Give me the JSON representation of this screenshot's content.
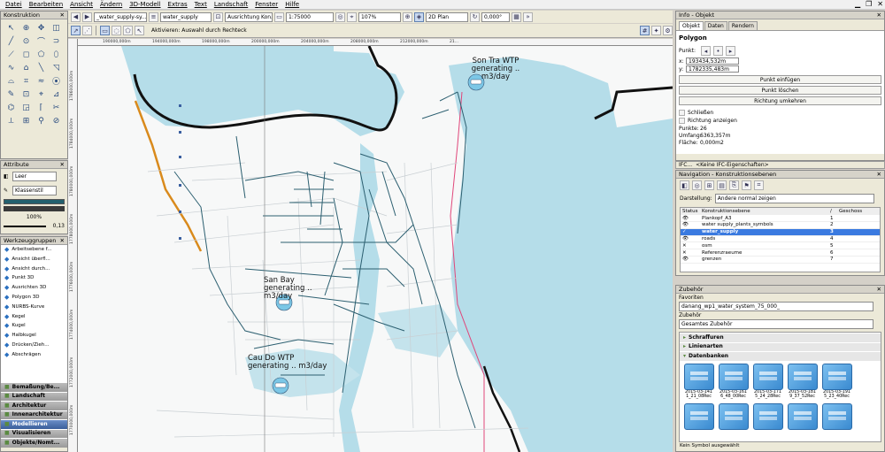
{
  "menu": [
    "Datei",
    "Bearbeiten",
    "Ansicht",
    "Ändern",
    "3D-Modell",
    "Extras",
    "Text",
    "Landschaft",
    "Fenster",
    "Hilfe"
  ],
  "toolbar1": {
    "layer_class": "_water_supply-sy...",
    "layer_name": "water_supply",
    "view": "Ausrichtung Kon...",
    "scale": "1:75000",
    "zoom": "107%",
    "plan": "2D Plan",
    "angle": "0,000°"
  },
  "toolbar2": {
    "mode_hint": "Aktivieren: Auswahl durch Rechteck"
  },
  "konstruktion": {
    "title": "Konstruktion"
  },
  "tools": [
    "↖",
    "⊕",
    "✥",
    "◫",
    "╱",
    "⊙",
    "⌒",
    "⊃",
    "⟋",
    "◻",
    "⬠",
    "⬯",
    "∿",
    "⌂",
    "╲",
    "◹",
    "⌓",
    "⌗",
    "≈",
    "⦿",
    "✎",
    "⊡",
    "⌖",
    "⊿",
    "⌬",
    "◲",
    "⌈",
    "✂",
    "⟂",
    "⊞",
    "⚲",
    "⊘"
  ],
  "attribute": {
    "title": "Attribute",
    "fill": "Leer",
    "pen": "Klassenstil",
    "opacity": "100%",
    "line_weight": "0,13"
  },
  "werkzeuggruppen": {
    "title": "Werkzeuggruppen",
    "items": [
      "Arbeitsebene f...",
      "Ansicht überfl...",
      "Ansicht durch...",
      "Punkt 3D",
      "Ausrichten 3D",
      "Polygon 3D",
      "NURBS-Kurve",
      "Kegel",
      "Kugel",
      "Halbkugel",
      "Drücken/Zieh...",
      "Abschrägen"
    ],
    "categories": [
      "Bemaßung/Be...",
      "Landschaft",
      "Architektur",
      "Innenarchitektur",
      "Modellieren",
      "Visualisieren",
      "Objekte/Nomt..."
    ],
    "selected_category": "Modellieren"
  },
  "ruler": {
    "x_ticks": [
      "190000,000m",
      "194000,000m",
      "198000,000m",
      "200000,000m",
      "204000,000m",
      "208000,000m",
      "212000,000m",
      "21..."
    ],
    "y_ticks": [
      "1786000,000m",
      "1784000,000m",
      "1780000,000m",
      "1778000,000m",
      "1776000,000m",
      "1774000,000m",
      "1772000,000m",
      "1770000,000m"
    ]
  },
  "map_labels": [
    {
      "title": "Son Tra WTP",
      "sub": "generating .. m3/day"
    },
    {
      "title": "San Bay",
      "sub": "generating .. m3/day"
    },
    {
      "title": "Cau Do WTP",
      "sub": "generating .. m3/day"
    }
  ],
  "info": {
    "title": "Info - Objekt",
    "tabs": [
      "Objekt",
      "Daten",
      "Rendern"
    ],
    "object_type": "Polygon",
    "punkt_label": "Punkt:",
    "x_label": "x:",
    "x_value": "193434,532m",
    "y_label": "y:",
    "y_value": "1782335,483m",
    "buttons": [
      "Punkt einfügen",
      "Punkt löschen",
      "Richtung umkehren"
    ],
    "checks": [
      "Schließen",
      "Richtung anzeigen"
    ],
    "stats": [
      {
        "label": "Punkte:",
        "value": "26"
      },
      {
        "label": "Umfang:",
        "value": "6363,357m"
      },
      {
        "label": "Fläche:",
        "value": "0,000m2"
      }
    ],
    "ifc_label": "IFC...",
    "ifc_value": "<Keine IFC-Eigenschaften>"
  },
  "navigation": {
    "title": "Navigation - Konstruktionsebenen",
    "darstellung_label": "Darstellung:",
    "darstellung_value": "Andere normal zeigen",
    "columns": [
      "Status",
      "Konstruktionsebene",
      "/",
      "Geschoss"
    ],
    "rows": [
      {
        "status": "👁",
        "name": "Plankopf_A3",
        "num": "1"
      },
      {
        "status": "👁",
        "name": "water supply_plants_symbols",
        "num": "2"
      },
      {
        "status": "✓",
        "name": "water_supply",
        "num": "3"
      },
      {
        "status": "👁",
        "name": "roads",
        "num": "4"
      },
      {
        "status": "✕",
        "name": "osm",
        "num": "5"
      },
      {
        "status": "✕",
        "name": "Referenzraeume",
        "num": "6"
      },
      {
        "status": "👁",
        "name": "grenzen",
        "num": "7"
      }
    ],
    "selected_row": 2
  },
  "zubehoer": {
    "title": "Zubehör",
    "favoriten_label": "Favoriten",
    "favoriten_value": "danang_wp1_water_system_75_000_",
    "zubehoer_label": "Zubehör",
    "zubehoer_value": "Gesamtes Zubehör",
    "sections": [
      "Schraffuren",
      "Linienarten",
      "Datenbanken"
    ],
    "items": [
      "2015-03-141 1_21_08Rec",
      "2015-03-161 6_48_00Rec",
      "2015-03-171 5_24_28Rec",
      "2015-03-181 9_37_52Rec",
      "2015-03-191 5_23_40Rec"
    ],
    "status": "Kein Symbol ausgewählt"
  }
}
